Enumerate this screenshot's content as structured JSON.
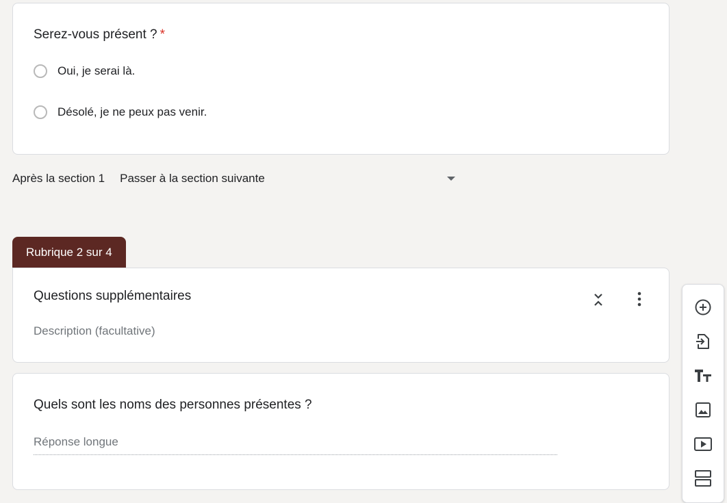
{
  "question1": {
    "title": "Serez-vous présent ?",
    "required_mark": "*",
    "options": [
      {
        "label": "Oui, je serai là."
      },
      {
        "label": "Désolé, je ne peux pas venir."
      }
    ]
  },
  "after_section": {
    "label": "Après la section 1",
    "selected": "Passer à la section suivante"
  },
  "section": {
    "tab_label": "Rubrique 2 sur 4",
    "title": "Questions supplémentaires",
    "description_placeholder": "Description (facultative)"
  },
  "question2": {
    "title": "Quels sont les noms des personnes présentes ?",
    "answer_placeholder": "Réponse longue"
  },
  "toolbar": {
    "icons": [
      "add-question-icon",
      "import-questions-icon",
      "add-title-icon",
      "add-image-icon",
      "add-video-icon",
      "add-section-icon"
    ]
  },
  "colors": {
    "accent": "#5c2823",
    "required": "#d93025",
    "background": "#f4f3f1"
  }
}
